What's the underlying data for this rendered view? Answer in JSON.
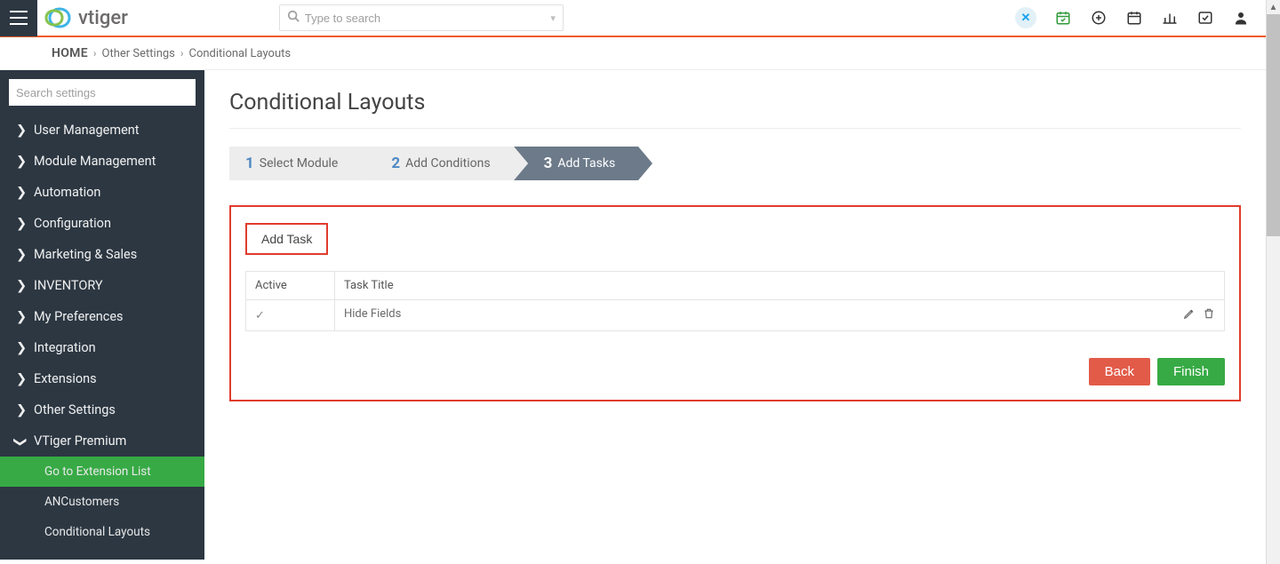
{
  "topbar": {
    "logo_text": "vtiger",
    "search_placeholder": "Type to search"
  },
  "breadcrumb": {
    "home": "HOME",
    "path1": "Other Settings",
    "path2": "Conditional Layouts"
  },
  "sidebar": {
    "search_placeholder": "Search settings",
    "items": [
      {
        "label": "User Management"
      },
      {
        "label": "Module Management"
      },
      {
        "label": "Automation"
      },
      {
        "label": "Configuration"
      },
      {
        "label": "Marketing & Sales"
      },
      {
        "label": "INVENTORY"
      },
      {
        "label": "My Preferences"
      },
      {
        "label": "Integration"
      },
      {
        "label": "Extensions"
      },
      {
        "label": "Other Settings"
      },
      {
        "label": "VTiger Premium"
      }
    ],
    "subitems": [
      {
        "label": "Go to Extension List",
        "active": true
      },
      {
        "label": "ANCustomers"
      },
      {
        "label": "Conditional Layouts"
      }
    ]
  },
  "page": {
    "title": "Conditional Layouts"
  },
  "steps": {
    "s1": {
      "num": "1",
      "label": "Select Module"
    },
    "s2": {
      "num": "2",
      "label": "Add Conditions"
    },
    "s3": {
      "num": "3",
      "label": "Add Tasks"
    }
  },
  "panel": {
    "add_task": "Add Task",
    "col_active": "Active",
    "col_title": "Task Title",
    "row0_title": "Hide Fields",
    "back": "Back",
    "finish": "Finish"
  }
}
